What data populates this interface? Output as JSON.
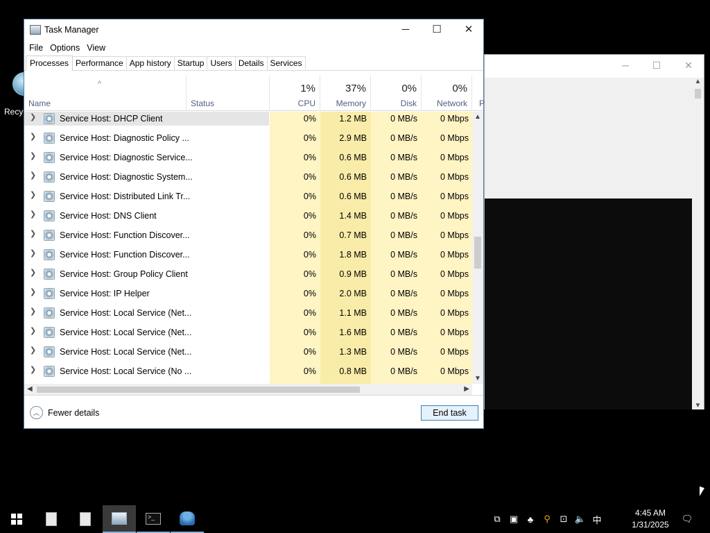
{
  "desktop": {
    "recycle_label": "Recy"
  },
  "task_manager": {
    "title": "Task Manager",
    "window_controls": {
      "minimize": "─",
      "maximize": "☐",
      "close": "✕"
    },
    "menu": [
      "File",
      "Options",
      "View"
    ],
    "tabs": [
      "Processes",
      "Performance",
      "App history",
      "Startup",
      "Users",
      "Details",
      "Services"
    ],
    "active_tab": "Processes",
    "sort_indicator": "^",
    "columns": {
      "name": "Name",
      "status": "Status",
      "cpu": {
        "pct": "1%",
        "label": "CPU"
      },
      "memory": {
        "pct": "37%",
        "label": "Memory"
      },
      "disk": {
        "pct": "0%",
        "label": "Disk"
      },
      "network": {
        "pct": "0%",
        "label": "Network"
      },
      "power": "P"
    },
    "rows": [
      {
        "name": "Service Host: DHCP Client",
        "cpu": "0%",
        "memory": "1.2 MB",
        "disk": "0 MB/s",
        "network": "0 Mbps",
        "selected": true
      },
      {
        "name": "Service Host: Diagnostic Policy ...",
        "cpu": "0%",
        "memory": "2.9 MB",
        "disk": "0 MB/s",
        "network": "0 Mbps"
      },
      {
        "name": "Service Host: Diagnostic Service...",
        "cpu": "0%",
        "memory": "0.6 MB",
        "disk": "0 MB/s",
        "network": "0 Mbps"
      },
      {
        "name": "Service Host: Diagnostic System...",
        "cpu": "0%",
        "memory": "0.6 MB",
        "disk": "0 MB/s",
        "network": "0 Mbps"
      },
      {
        "name": "Service Host: Distributed Link Tr...",
        "cpu": "0%",
        "memory": "0.6 MB",
        "disk": "0 MB/s",
        "network": "0 Mbps"
      },
      {
        "name": "Service Host: DNS Client",
        "cpu": "0%",
        "memory": "1.4 MB",
        "disk": "0 MB/s",
        "network": "0 Mbps"
      },
      {
        "name": "Service Host: Function Discover...",
        "cpu": "0%",
        "memory": "0.7 MB",
        "disk": "0 MB/s",
        "network": "0 Mbps"
      },
      {
        "name": "Service Host: Function Discover...",
        "cpu": "0%",
        "memory": "1.8 MB",
        "disk": "0 MB/s",
        "network": "0 Mbps"
      },
      {
        "name": "Service Host: Group Policy Client",
        "cpu": "0%",
        "memory": "0.9 MB",
        "disk": "0 MB/s",
        "network": "0 Mbps"
      },
      {
        "name": "Service Host: IP Helper",
        "cpu": "0%",
        "memory": "2.0 MB",
        "disk": "0 MB/s",
        "network": "0 Mbps"
      },
      {
        "name": "Service Host: Local Service (Net...",
        "cpu": "0%",
        "memory": "1.1 MB",
        "disk": "0 MB/s",
        "network": "0 Mbps"
      },
      {
        "name": "Service Host: Local Service (Net...",
        "cpu": "0%",
        "memory": "1.6 MB",
        "disk": "0 MB/s",
        "network": "0 Mbps"
      },
      {
        "name": "Service Host: Local Service (Net...",
        "cpu": "0%",
        "memory": "1.3 MB",
        "disk": "0 MB/s",
        "network": "0 Mbps"
      },
      {
        "name": "Service Host: Local Service (No ...",
        "cpu": "0%",
        "memory": "0.8 MB",
        "disk": "0 MB/s",
        "network": "0 Mbps"
      }
    ],
    "footer": {
      "fewer_details": "Fewer details",
      "end_task": "End task"
    }
  },
  "background_window": {
    "minimize": "─",
    "maximize": "☐",
    "close": "✕"
  },
  "taskbar": {
    "items": [
      "start-button",
      "file-icon",
      "file-icon",
      "task-manager-icon",
      "cmd-icon",
      "people-icon"
    ],
    "tray": {
      "ime": "中"
    },
    "clock": {
      "time": "4:45 AM",
      "date": "1/31/2025"
    }
  },
  "colors": {
    "heat_light": "#fff4c4",
    "heat_mid": "#f9eca8",
    "selection": "#e5e5e5",
    "accent": "#3c7fb1"
  }
}
